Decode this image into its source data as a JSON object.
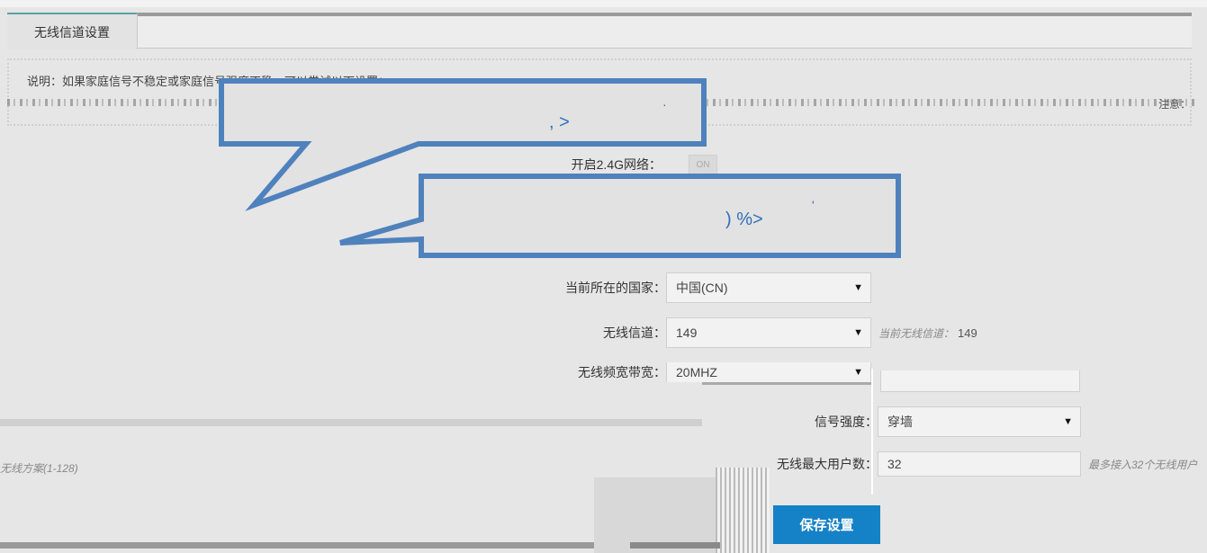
{
  "tab": {
    "label": "无线信道设置"
  },
  "notice": {
    "text": "说明：如果家庭信号不稳定或家庭信号强度不稳，可以尝试以下设置：",
    "right_text": "注意："
  },
  "form": {
    "enable_24g": {
      "label": "开启2.4G网络：",
      "toggle_text": "ON"
    },
    "country": {
      "label": "当前所在的国家：",
      "value": "中国(CN)"
    },
    "channel": {
      "label": "无线信道：",
      "value": "149",
      "hint": "当前无线信道：",
      "hint_value": "149"
    },
    "bandwidth": {
      "label": "无线频宽带宽：",
      "value": "20MHZ"
    },
    "signal": {
      "label": "信号强度：",
      "value": "穿墙"
    },
    "max_users": {
      "label": "无线最大用户数：",
      "value": "32",
      "hint": "最多接入32个无线用户"
    }
  },
  "left_hint": "无线方案(1-128)",
  "save_button": "保存设置",
  "bubbles": {
    "first": ", >",
    "first_dot": "·",
    "second": ") %>",
    "second_dot": "'"
  }
}
